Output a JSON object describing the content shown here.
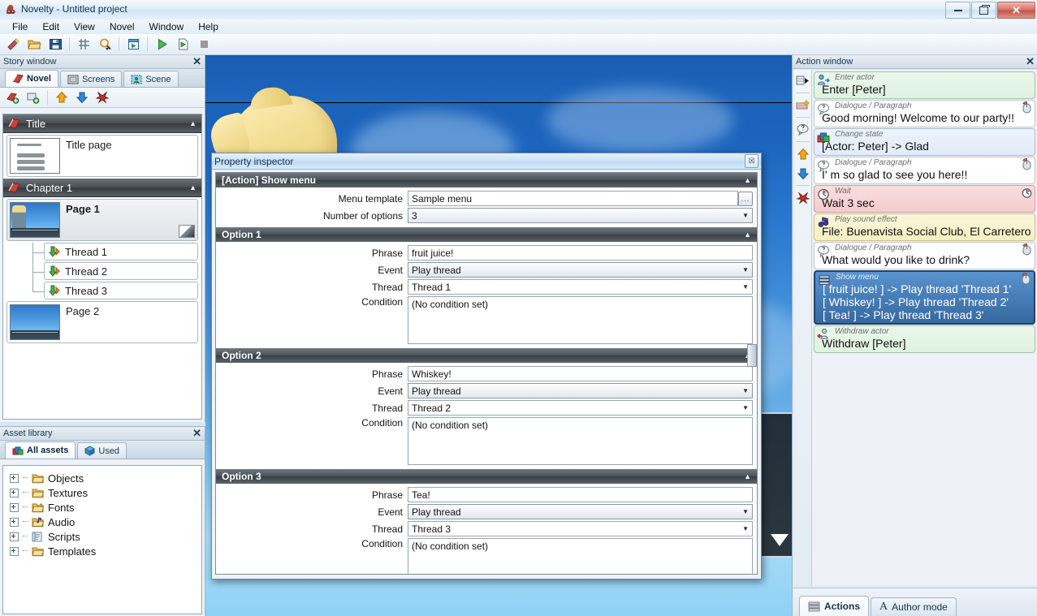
{
  "window": {
    "title": "Novelty - Untitled project",
    "app_icon": "novelty-icon",
    "minimize": "minimize",
    "restore": "restore",
    "close": "close"
  },
  "menubar": {
    "items": [
      "File",
      "Edit",
      "View",
      "Novel",
      "Window",
      "Help"
    ]
  },
  "toolbar": {
    "buttons": [
      {
        "name": "new-project-icon",
        "title": "New"
      },
      {
        "name": "open-project-icon",
        "title": "Open"
      },
      {
        "name": "save-project-icon",
        "title": "Save"
      },
      {
        "name": "grid-icon",
        "title": "Grid"
      },
      {
        "name": "zoom-icon",
        "title": "Zoom"
      },
      {
        "name": "preview-icon",
        "title": "Preview"
      },
      {
        "name": "play-icon",
        "title": "Play"
      },
      {
        "name": "play-from-page-icon",
        "title": "Play from page"
      },
      {
        "name": "stop-icon",
        "title": "Stop"
      }
    ]
  },
  "story_window": {
    "title": "Story window",
    "close_label": "✕",
    "tabs": [
      {
        "label": "Novel",
        "icon": "book-icon",
        "active": true
      },
      {
        "label": "Screens",
        "icon": "screen-icon",
        "active": false
      },
      {
        "label": "Scene",
        "icon": "scene-icon",
        "active": false
      }
    ],
    "tool_buttons": [
      {
        "name": "add-chapter-icon"
      },
      {
        "name": "add-page-icon"
      },
      {
        "name": "move-up-icon"
      },
      {
        "name": "move-down-icon"
      },
      {
        "name": "delete-icon"
      }
    ],
    "groups": [
      {
        "label": "Title",
        "icon": "book-icon",
        "collapse": "▲",
        "nodes": [
          {
            "label": "Title page",
            "bold": false,
            "kind": "title",
            "selected": false
          }
        ]
      },
      {
        "label": "Chapter 1",
        "icon": "book-icon",
        "collapse": "▲",
        "nodes": [
          {
            "label": "Page 1",
            "bold": true,
            "kind": "page-char",
            "selected": true
          },
          {
            "label": "Page 2",
            "bold": false,
            "kind": "page-plain",
            "selected": false
          }
        ],
        "threads": [
          "Thread 1",
          "Thread 2",
          "Thread 3"
        ]
      }
    ]
  },
  "asset_library": {
    "title": "Asset library",
    "close_label": "✕",
    "tabs": [
      {
        "label": "All assets",
        "icon": "assets-icon",
        "active": true
      },
      {
        "label": "Used",
        "icon": "cube-icon",
        "active": false
      }
    ],
    "folders": [
      "Objects",
      "Textures",
      "Fonts",
      "Audio",
      "Scripts",
      "Templates"
    ]
  },
  "property_inspector": {
    "title": "Property inspector",
    "close_label": "☒",
    "sections": [
      {
        "title": "[Action] Show menu",
        "collapse": "▲",
        "fields": [
          {
            "label": "Menu template",
            "value": "Sample menu",
            "type": "text-ellipsis",
            "button": "..."
          },
          {
            "label": "Number of options",
            "value": "3",
            "type": "combo"
          }
        ]
      },
      {
        "title": "Option 1",
        "collapse": "▲",
        "fields": [
          {
            "label": "Phrase",
            "value": "fruit juice!",
            "type": "text"
          },
          {
            "label": "Event",
            "value": "Play thread",
            "type": "combo"
          },
          {
            "label": "Thread",
            "value": "Thread 1",
            "type": "combo-flat"
          },
          {
            "label": "Condition",
            "value": "(No condition set)",
            "type": "textarea"
          }
        ]
      },
      {
        "title": "Option 2",
        "collapse": "▲",
        "fields": [
          {
            "label": "Phrase",
            "value": "Whiskey!",
            "type": "text"
          },
          {
            "label": "Event",
            "value": "Play thread",
            "type": "combo"
          },
          {
            "label": "Thread",
            "value": "Thread 2",
            "type": "combo-flat"
          },
          {
            "label": "Condition",
            "value": "(No condition set)",
            "type": "textarea"
          }
        ]
      },
      {
        "title": "Option 3",
        "collapse": "▲",
        "fields": [
          {
            "label": "Phrase",
            "value": "Tea!",
            "type": "text"
          },
          {
            "label": "Event",
            "value": "Play thread",
            "type": "combo"
          },
          {
            "label": "Thread",
            "value": "Thread 3",
            "type": "combo-flat"
          },
          {
            "label": "Condition",
            "value": "(No condition set)",
            "type": "textarea"
          }
        ]
      }
    ]
  },
  "action_window": {
    "title": "Action window",
    "close_label": "✕",
    "tool_buttons": [
      {
        "name": "insert-action-icon"
      },
      {
        "name": "add-paragraph-icon"
      },
      {
        "name": "add-dialogue-icon"
      },
      {
        "name": "move-up-icon"
      },
      {
        "name": "move-down-icon"
      },
      {
        "name": "delete-action-icon"
      }
    ],
    "actions": [
      {
        "kind": "Enter actor",
        "text": "Enter [Peter]",
        "style": "green",
        "icon": "enter-actor-icon",
        "right_icon": null,
        "selected": false
      },
      {
        "kind": "Dialogue / Paragraph",
        "text": "Good morning! Welcome to our party!!",
        "style": "white",
        "icon": "dialogue-icon",
        "right_icon": "mouse-icon",
        "selected": false
      },
      {
        "kind": "Change state",
        "text": "[Actor: Peter] -> Glad",
        "style": "blue",
        "icon": "change-state-icon",
        "right_icon": null,
        "selected": false
      },
      {
        "kind": "Dialogue / Paragraph",
        "text": "I' m so glad to see you here!!",
        "style": "white",
        "icon": "dialogue-icon",
        "right_icon": "mouse-icon",
        "selected": false
      },
      {
        "kind": "Wait",
        "text": "Wait 3 sec",
        "style": "red",
        "icon": "clock-icon",
        "right_icon": "clock-icon",
        "selected": false
      },
      {
        "kind": "Play sound effect",
        "text": "File: Buenavista Social Club, El Carretero",
        "style": "yellow",
        "icon": "sound-icon",
        "right_icon": null,
        "selected": false
      },
      {
        "kind": "Dialogue / Paragraph",
        "text": "What would you like to drink?",
        "style": "white",
        "icon": "dialogue-icon",
        "right_icon": "mouse-icon",
        "selected": false
      },
      {
        "kind": "Show menu",
        "text": "[ fruit juice! ] -> Play thread 'Thread 1'\n[ Whiskey! ] -> Play thread 'Thread 2'\n[ Tea! ] -> Play thread 'Thread 3'",
        "style": "white",
        "icon": "menu-icon",
        "right_icon": "mouse-icon",
        "selected": true
      },
      {
        "kind": "Withdraw actor",
        "text": "Withdraw [Peter]",
        "style": "green",
        "icon": "withdraw-actor-icon",
        "right_icon": null,
        "selected": false
      }
    ],
    "tabs": [
      {
        "label": "Actions",
        "icon": "actions-icon",
        "active": true
      },
      {
        "label": "Author mode",
        "icon": "author-icon",
        "active": false
      }
    ]
  }
}
